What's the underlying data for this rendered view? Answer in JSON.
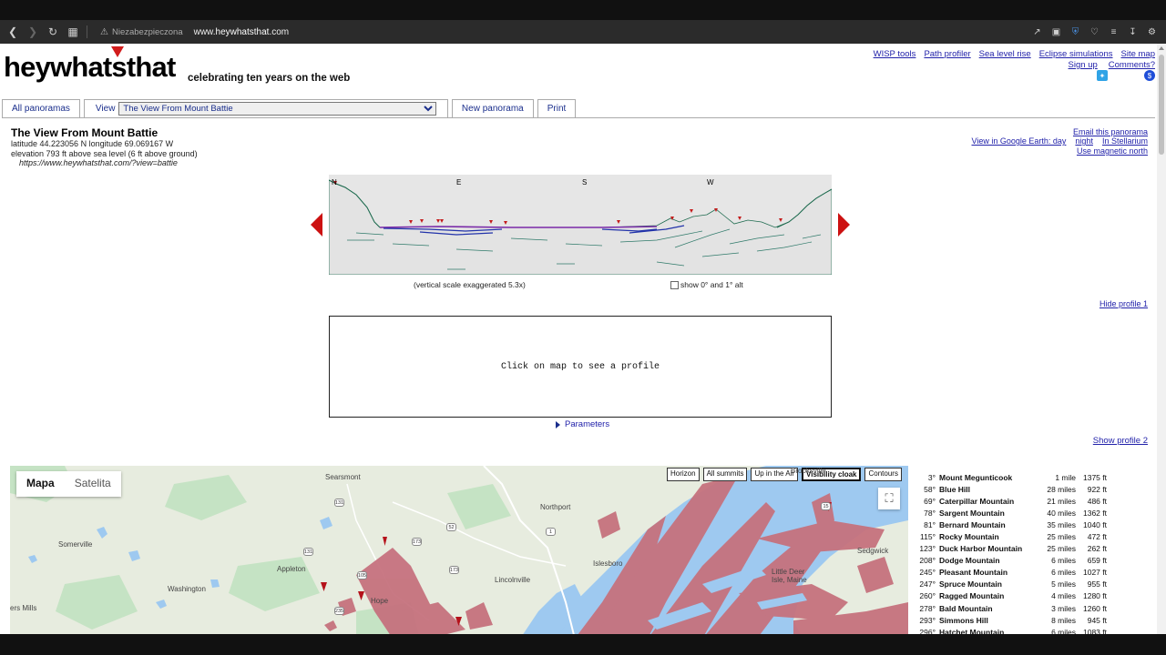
{
  "browser": {
    "insecure_label": "Niezabezpieczona",
    "url_prefix": "www.",
    "url_domain": "heywhatsthat",
    "url_suffix": ".com"
  },
  "site": {
    "logo": "heywhatsthat",
    "tagline": "celebrating ten years on the web",
    "top_links": [
      "WISP tools",
      "Path profiler",
      "Sea level rise",
      "Eclipse simulations",
      "Site map"
    ],
    "signup": "Sign up",
    "comments": "Comments?",
    "dollar": "$"
  },
  "tabs": {
    "all_panoramas": "All panoramas",
    "view_label": "View",
    "view_selected": "The View From Mount Battie",
    "new_panorama": "New panorama",
    "print": "Print"
  },
  "panorama": {
    "title": "The View From Mount Battie",
    "coords": "latitude 44.223056 N longitude 69.069167 W",
    "elevation": "elevation 793 ft above sea level (6 ft above ground)",
    "url": "https://www.heywhatsthat.com/?view=battie",
    "email": "Email this panorama",
    "google_earth_prefix": "View in Google Earth: day",
    "night": "night",
    "stellarium": "In Stellarium",
    "magnetic": "Use magnetic north",
    "dirs": [
      "N",
      "E",
      "S",
      "W"
    ],
    "vscale": "(vertical scale exaggerated 5.3x)",
    "show_alt": "show 0° and 1° alt",
    "hide_profile1": "Hide profile 1",
    "profile_hint": "Click on map to see a profile",
    "parameters": "Parameters",
    "show_profile2": "Show profile 2"
  },
  "map": {
    "type_map": "Mapa",
    "type_sat": "Satelita",
    "overlays": [
      "Horizon",
      "All summits",
      "Up in the Air",
      "Visibility cloak",
      "Contours"
    ],
    "active_overlay": "Visibility cloak",
    "places": {
      "searsmont": "Searsmont",
      "northport": "Northport",
      "brooksville": "Brooksville",
      "somerville": "Somerville",
      "appleton": "Appleton",
      "washington": "Washington",
      "lincolnville": "Lincolnville",
      "islesboro": "Islesboro",
      "little_deer": "Little Deer",
      "isle_maine": "Isle, Maine",
      "sedgwick": "Sedgwick",
      "hope": "Hope",
      "mills": "ers Mills"
    },
    "routes": [
      "131",
      "173",
      "1",
      "52",
      "173",
      "131",
      "105",
      "235",
      "15"
    ],
    "colors": {
      "land": "#e7ecdf",
      "water": "#9ec9f0",
      "cloak": "#c6727e",
      "green": "#c5e3c4"
    }
  },
  "summits": [
    {
      "az": "3°",
      "name": "Mount Megunticook",
      "dist": "1 mile",
      "elev": "1375 ft"
    },
    {
      "az": "58°",
      "name": "Blue Hill",
      "dist": "28 miles",
      "elev": "922 ft"
    },
    {
      "az": "69°",
      "name": "Caterpillar Mountain",
      "dist": "21 miles",
      "elev": "486 ft"
    },
    {
      "az": "78°",
      "name": "Sargent Mountain",
      "dist": "40 miles",
      "elev": "1362 ft"
    },
    {
      "az": "81°",
      "name": "Bernard Mountain",
      "dist": "35 miles",
      "elev": "1040 ft"
    },
    {
      "az": "115°",
      "name": "Rocky Mountain",
      "dist": "25 miles",
      "elev": "472 ft"
    },
    {
      "az": "123°",
      "name": "Duck Harbor Mountain",
      "dist": "25 miles",
      "elev": "262 ft"
    },
    {
      "az": "208°",
      "name": "Dodge Mountain",
      "dist": "6 miles",
      "elev": "659 ft"
    },
    {
      "az": "245°",
      "name": "Pleasant Mountain",
      "dist": "6 miles",
      "elev": "1027 ft"
    },
    {
      "az": "247°",
      "name": "Spruce Mountain",
      "dist": "5 miles",
      "elev": "955 ft"
    },
    {
      "az": "260°",
      "name": "Ragged Mountain",
      "dist": "4 miles",
      "elev": "1280 ft"
    },
    {
      "az": "278°",
      "name": "Bald Mountain",
      "dist": "3 miles",
      "elev": "1260 ft"
    },
    {
      "az": "293°",
      "name": "Simmons Hill",
      "dist": "8 miles",
      "elev": "945 ft"
    },
    {
      "az": "296°",
      "name": "Hatchet Mountain",
      "dist": "6 miles",
      "elev": "1083 ft"
    }
  ]
}
